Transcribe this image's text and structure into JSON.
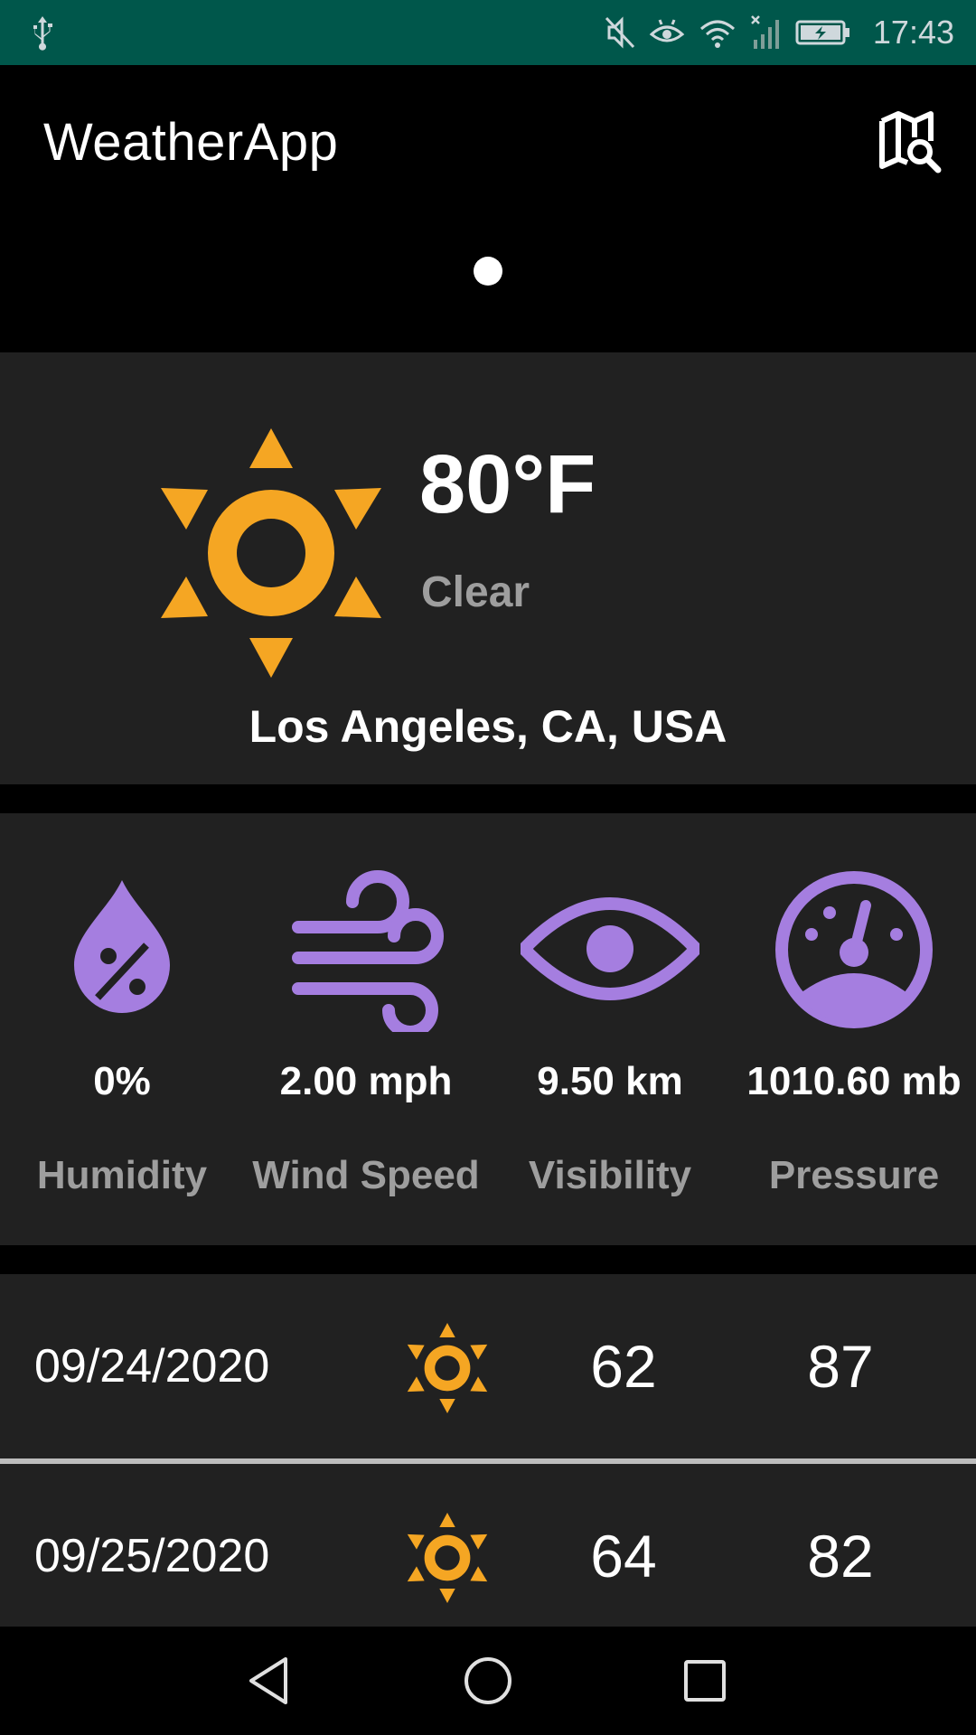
{
  "status_bar": {
    "time": "17:43",
    "icons": [
      "usb-icon",
      "mute-icon",
      "eye-comfort-icon",
      "wifi-icon",
      "signal-icon",
      "battery-charging-icon"
    ]
  },
  "app_bar": {
    "title": "WeatherApp",
    "action_icon": "map-search-icon"
  },
  "pager": {
    "active_index": 0,
    "count": 1
  },
  "current": {
    "icon": "sun-icon",
    "temperature": "80°F",
    "condition": "Clear",
    "location": "Los Angeles, CA, USA"
  },
  "stats": [
    {
      "icon": "humidity-icon",
      "value": "0%",
      "label": "Humidity"
    },
    {
      "icon": "wind-icon",
      "value": "2.00 mph",
      "label": "Wind Speed"
    },
    {
      "icon": "visibility-icon",
      "value": "9.50 km",
      "label": "Visibility"
    },
    {
      "icon": "pressure-gauge-icon",
      "value": "1010.60 mb",
      "label": "Pressure"
    }
  ],
  "forecast": [
    {
      "date": "09/24/2020",
      "icon": "sun-icon",
      "low": "62",
      "high": "87"
    },
    {
      "date": "09/25/2020",
      "icon": "sun-icon",
      "low": "64",
      "high": "82"
    }
  ],
  "colors": {
    "status_bar": "#00574b",
    "card_background": "#212121",
    "sun": "#f5a623",
    "stat_icon": "#a57ee0",
    "secondary_text": "#9e9e9e",
    "divider": "#bdbdbd"
  },
  "nav_bar": {
    "buttons": [
      "back-icon",
      "home-icon",
      "recents-icon"
    ]
  }
}
